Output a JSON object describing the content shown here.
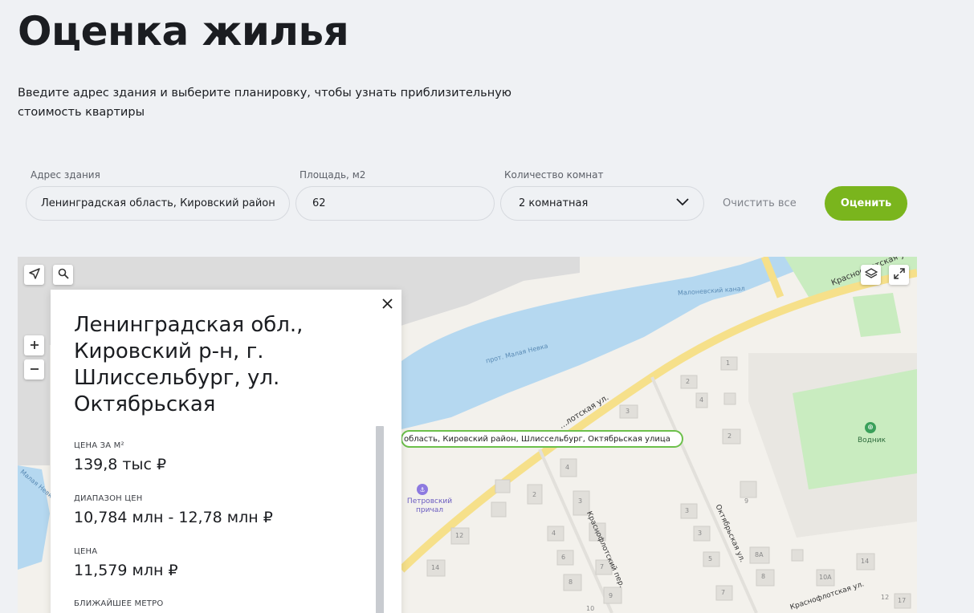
{
  "header": {
    "title": "Оценка жилья",
    "description": "Введите адрес здания и выберите планировку, чтобы узнать приблизительную стоимость квартиры"
  },
  "form": {
    "address": {
      "label": "Адрес здания",
      "value": "Ленинградская область, Кировский район"
    },
    "area": {
      "label": "Площадь, м2",
      "value": "62"
    },
    "rooms": {
      "label": "Количество комнат",
      "value": "2 комнатная"
    },
    "clear_label": "Очистить все",
    "submit_label": "Оценить"
  },
  "colors": {
    "accent": "#7ab51d",
    "water": "#b5d8f0",
    "road": "#f6e08a",
    "green": "#c9ecc0"
  },
  "map": {
    "marker_address": "область, Кировский район, Шлиссельбург, Октябрьская улица",
    "labels": {
      "canal": "Малоневский канал",
      "river": "прот. Малая Невка",
      "street_oktyabrskaya": "Октябрьская ул.",
      "street_krasnoflotsky": "Краснофлотский пер.",
      "street_krasnoflotskaya": "Краснофлотская ул.",
      "street_partial": "…лотская ул.",
      "street_top": "Краснофлотская ул.",
      "left_water": "Малая Невка",
      "stadium": "Водник",
      "pier": "Петровский причал"
    },
    "house_numbers": [
      "1",
      "2",
      "4",
      "2",
      "3",
      "3",
      "4",
      "2",
      "12",
      "14",
      "3",
      "4",
      "5",
      "6",
      "7",
      "8",
      "9",
      "10",
      "3",
      "5",
      "7",
      "9",
      "8А",
      "8",
      "10А",
      "14",
      "12",
      "17"
    ]
  },
  "card": {
    "title": "Ленинградская обл., Кировский р-н, г. Шлиссельбург, ул. Октябрьская",
    "price_per_m2_label": "ЦЕНА ЗА М²",
    "price_per_m2": "139,8 тыс ₽",
    "range_label": "ДИАПАЗОН ЦЕН",
    "range": "10,784 млн - 12,78 млн ₽",
    "price_label": "ЦЕНА",
    "price": "11,579 млн ₽",
    "metro_label": "БЛИЖАЙШЕЕ МЕТРО"
  }
}
